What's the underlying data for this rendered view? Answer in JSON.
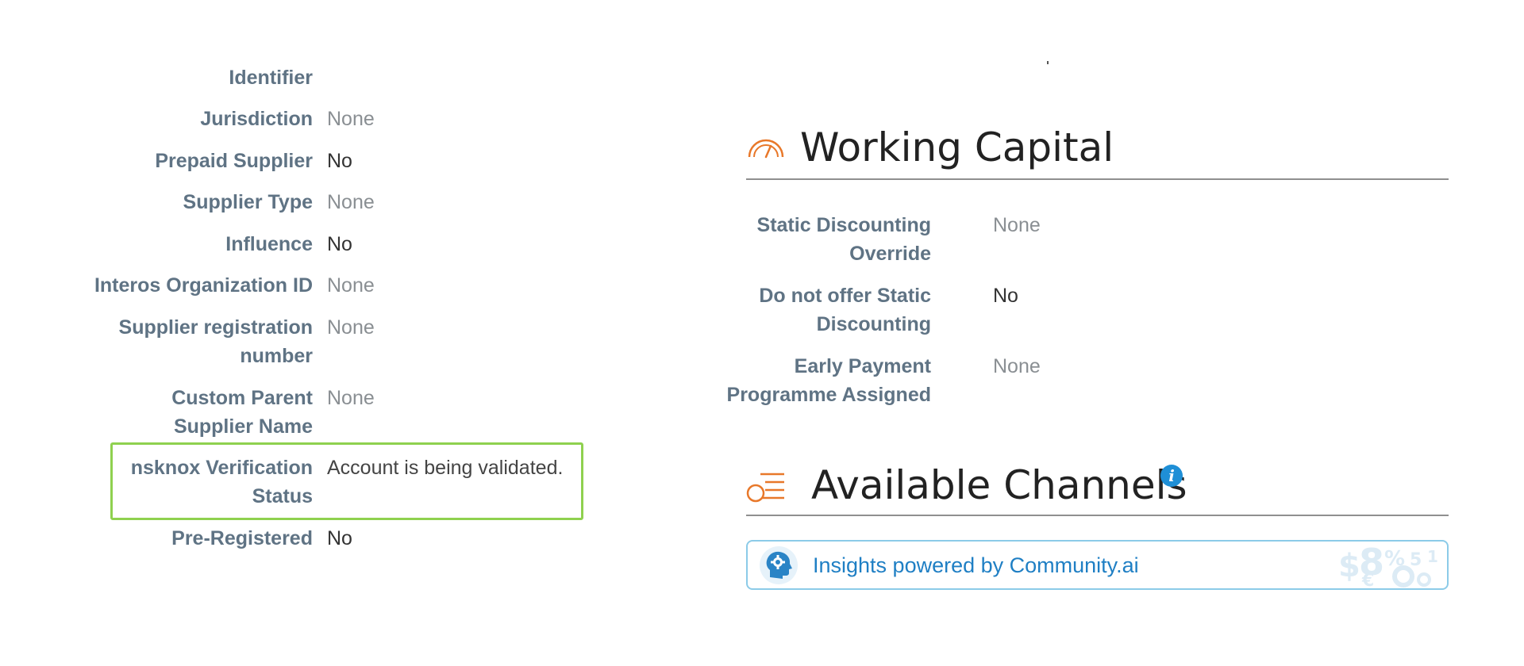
{
  "left_fields": [
    {
      "label": "Identifier",
      "value": ""
    },
    {
      "label": "Jurisdiction",
      "value": "None"
    },
    {
      "label": "Prepaid Supplier",
      "value": "No"
    },
    {
      "label": "Supplier Type",
      "value": "None"
    },
    {
      "label": "Influence",
      "value": "No"
    },
    {
      "label": "Interos Organization ID",
      "value": "None"
    },
    {
      "label": "Supplier registration number",
      "value": "None"
    },
    {
      "label": "Custom Parent Supplier Name",
      "value": "None"
    },
    {
      "label": "nsknox Verification Status",
      "value": "Account is being validated."
    },
    {
      "label": "Pre-Registered",
      "value": "No"
    }
  ],
  "working_capital": {
    "title": "Working Capital",
    "icon": "gauge-icon",
    "fields": [
      {
        "label": "Static Discounting Override",
        "value": "None"
      },
      {
        "label": "Do not offer Static Discounting",
        "value": "No"
      },
      {
        "label": "Early Payment Programme Assigned",
        "value": "None"
      }
    ]
  },
  "available_channels": {
    "title": "Available Channels",
    "icon": "channels-list-icon",
    "info_icon": "info-icon",
    "info_glyph": "i"
  },
  "insights": {
    "text": "Insights powered by Community.ai",
    "icon": "ai-head-gear-icon",
    "watermark": "currency-symbols-watermark"
  },
  "colors": {
    "label": "#5f7384",
    "accent_orange": "#e8782a",
    "highlight_green": "#8fd14f",
    "link_blue": "#1f7fc4",
    "info_blue": "#1f8fd6"
  }
}
